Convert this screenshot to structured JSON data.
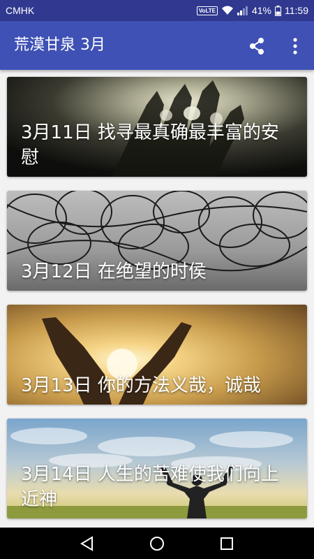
{
  "status_bar": {
    "carrier": "CMHK",
    "volte": "VoLTE",
    "battery": "41%",
    "time": "11:59"
  },
  "app_bar": {
    "title": "荒漠甘泉 3月",
    "actions": [
      "share-icon",
      "more-vert-icon"
    ]
  },
  "entries": [
    {
      "title": "3月11日 找寻最真确最丰富的安慰",
      "image": "hand-light-dark"
    },
    {
      "title": "3月12日 在绝望的时侯",
      "image": "barbed-wire-sky"
    },
    {
      "title": "3月13日 你的方法义哉，诚哉",
      "image": "hands-sunset"
    },
    {
      "title": "3月14日 人生的苦难使我们向上近神",
      "image": "man-arms-sky"
    }
  ],
  "nav_bar": [
    "back-icon",
    "home-icon",
    "recents-icon"
  ],
  "colors": {
    "status_bar": "#30398f",
    "app_bar": "#3f51b5",
    "background": "#f2f2f2",
    "nav_bar": "#000000"
  }
}
